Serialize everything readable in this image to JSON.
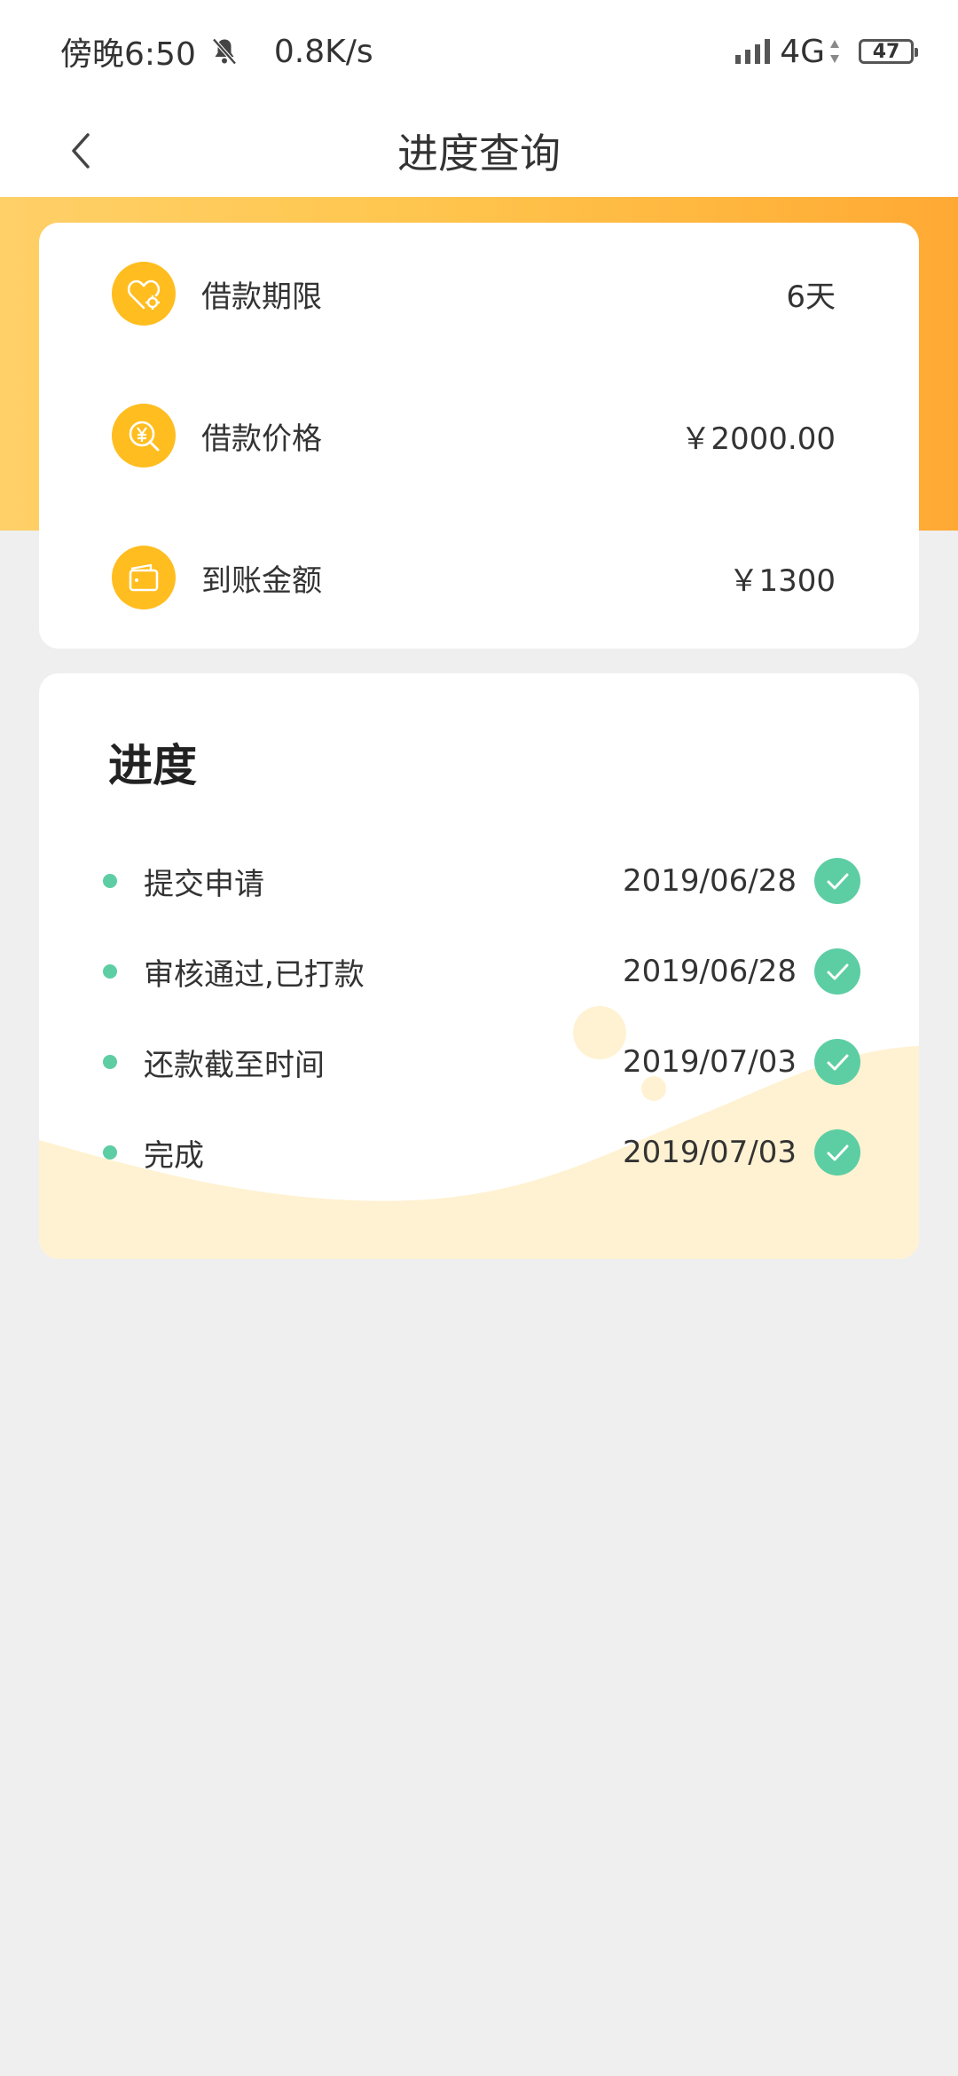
{
  "status_bar": {
    "time": "傍晚6:50",
    "net_speed": "0.8K/s",
    "network": "4G",
    "battery": "47"
  },
  "header": {
    "title": "进度查询"
  },
  "summary": {
    "items": [
      {
        "icon": "heart-gear-icon",
        "label": "借款期限",
        "value": "6天"
      },
      {
        "icon": "yen-search-icon",
        "label": "借款价格",
        "value": "￥2000.00"
      },
      {
        "icon": "wallet-icon",
        "label": "到账金额",
        "value": "￥1300"
      }
    ]
  },
  "progress": {
    "title": "进度",
    "steps": [
      {
        "label": "提交申请",
        "date": "2019/06/28"
      },
      {
        "label": "审核通过,已打款",
        "date": "2019/06/28"
      },
      {
        "label": "还款截至时间",
        "date": "2019/07/03"
      },
      {
        "label": "完成",
        "date": "2019/07/03"
      }
    ]
  },
  "colors": {
    "accent": "#ffbd1f",
    "banner_start": "#ffd068",
    "banner_end": "#ffa934",
    "success": "#5dcea3",
    "background": "#efefef",
    "wave": "#fff2d2"
  }
}
